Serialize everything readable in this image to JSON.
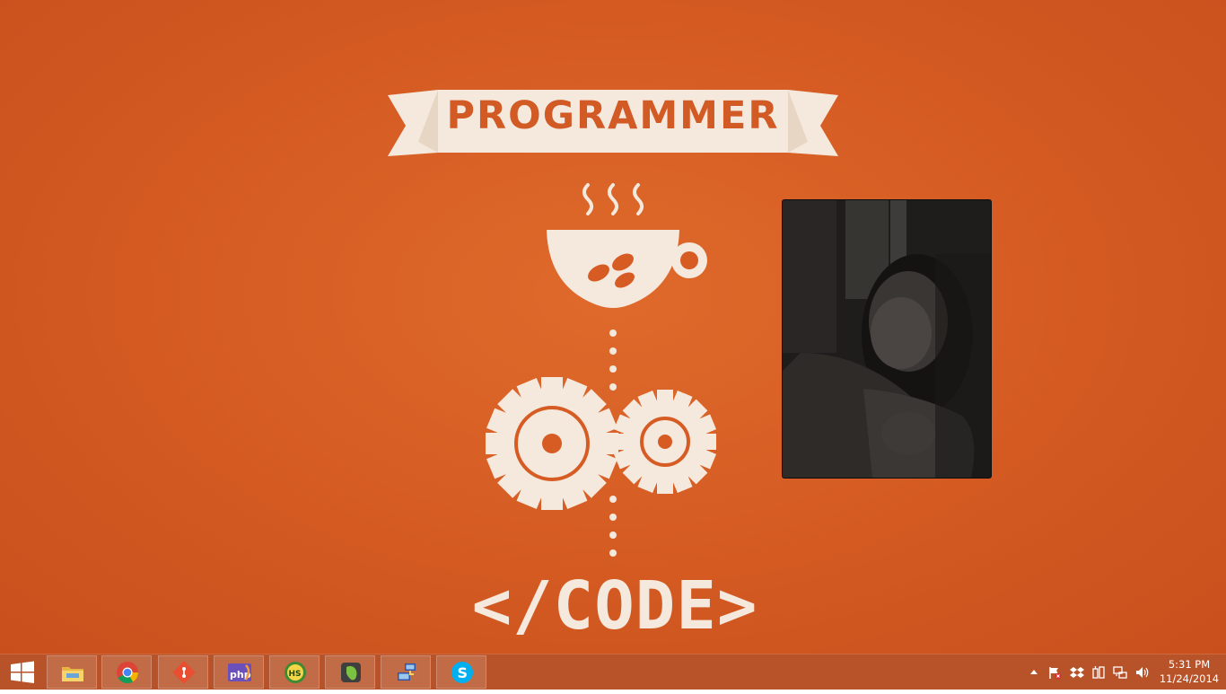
{
  "wallpaper": {
    "banner_text": "PROGRAMMER",
    "code_text": "</CODE>",
    "background_color": "#d45a22",
    "art_color": "#f5e8dc"
  },
  "video_window": {
    "content": "webcam-video-feed"
  },
  "taskbar": {
    "color": "#b85329",
    "start_icon": "windows-logo-icon",
    "pinned_apps": [
      {
        "name": "File Explorer",
        "icon": "folder-icon"
      },
      {
        "name": "Google Chrome",
        "icon": "chrome-icon"
      },
      {
        "name": "Git",
        "icon": "git-icon"
      },
      {
        "name": "phpStorm",
        "icon": "php-icon"
      },
      {
        "name": "HeidiSQL",
        "icon": "hs-icon"
      },
      {
        "name": "Evernote",
        "icon": "evernote-icon"
      },
      {
        "name": "Remote Desktop",
        "icon": "network-computer-icon"
      },
      {
        "name": "Skype",
        "icon": "skype-icon"
      }
    ],
    "tray_icons": [
      "show-hidden-icons-arrow",
      "action-center-flag-icon",
      "dropbox-icon",
      "device-icon",
      "network-icon",
      "volume-icon"
    ],
    "clock": {
      "time": "5:31 PM",
      "date": "11/24/2014"
    }
  }
}
